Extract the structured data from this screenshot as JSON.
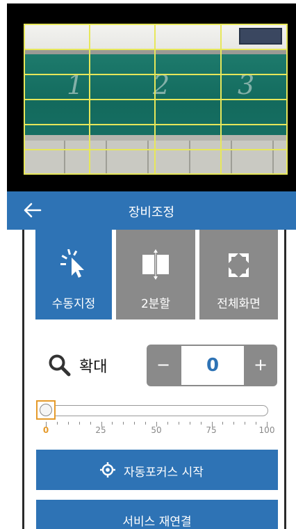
{
  "camera": {
    "zones": [
      "1",
      "2",
      "3"
    ]
  },
  "header": {
    "title": "장비조정",
    "back_icon": "arrow-left-icon"
  },
  "modes": [
    {
      "label": "수동지정",
      "icon": "cursor-pointer-icon",
      "selected": true
    },
    {
      "label": "2분할",
      "icon": "split-view-icon",
      "selected": false
    },
    {
      "label": "전체화면",
      "icon": "fullscreen-arrows-icon",
      "selected": false
    }
  ],
  "zoom": {
    "label": "확대",
    "icon": "search-icon",
    "minus": "−",
    "plus": "+",
    "value": "0"
  },
  "slider": {
    "min": 0,
    "max": 100,
    "value": 0,
    "labels": [
      "0",
      "25",
      "50",
      "75",
      "100"
    ]
  },
  "buttons": {
    "autofocus_label": "자동포커스 시작",
    "autofocus_icon": "crosshair-target-icon",
    "reconnect_label": "서비스 재연결"
  },
  "colors": {
    "primary": "#2e73b5",
    "inactive": "#8a8a8a",
    "grid": "#e7e75a",
    "slider_accent": "#e59a2a"
  }
}
